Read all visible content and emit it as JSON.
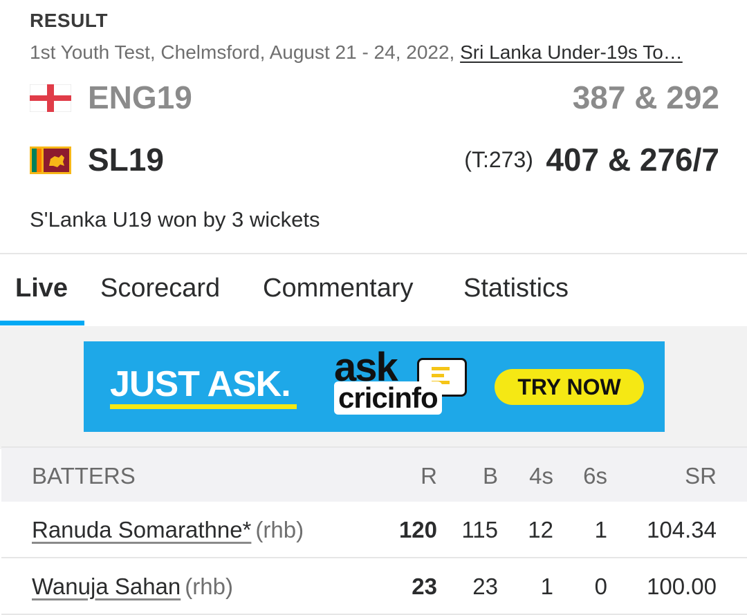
{
  "header": {
    "status": "RESULT",
    "match_desc": "1st Youth Test, Chelmsford, August 21 - 24, 2022, ",
    "series_link": "Sri Lanka Under-19s To…"
  },
  "teams": [
    {
      "name": "ENG19",
      "target": "",
      "score": "387 & 292",
      "flag": "england-flag-icon"
    },
    {
      "name": "SL19",
      "target": "(T:273)",
      "score": "407 & 276/7",
      "flag": "sri-lanka-flag-icon"
    }
  ],
  "result_text": "S'Lanka U19 won by 3 wickets",
  "tabs": [
    {
      "label": "Live",
      "active": true
    },
    {
      "label": "Scorecard",
      "active": false
    },
    {
      "label": "Commentary",
      "active": false
    },
    {
      "label": "Statistics",
      "active": false
    }
  ],
  "banner": {
    "tagline": "JUST ASK.",
    "logo_top": "ask",
    "logo_bottom": "cricinfo",
    "cta": "TRY NOW",
    "colors": {
      "background": "#1ea8e8",
      "accent": "#f5e814"
    }
  },
  "batters_table": {
    "headers": [
      "BATTERS",
      "R",
      "B",
      "4s",
      "6s",
      "SR"
    ],
    "rows": [
      {
        "name": "Ranuda Somarathne*",
        "hand": "(rhb)",
        "r": "120",
        "b": "115",
        "fours": "12",
        "sixes": "1",
        "sr": "104.34"
      },
      {
        "name": "Wanuja Sahan",
        "hand": "(rhb)",
        "r": "23",
        "b": "23",
        "fours": "1",
        "sixes": "0",
        "sr": "100.00"
      }
    ]
  },
  "colors": {
    "tab_accent": "#03a9f4",
    "muted": "#8b8b8b",
    "text": "#2b2c2d"
  }
}
